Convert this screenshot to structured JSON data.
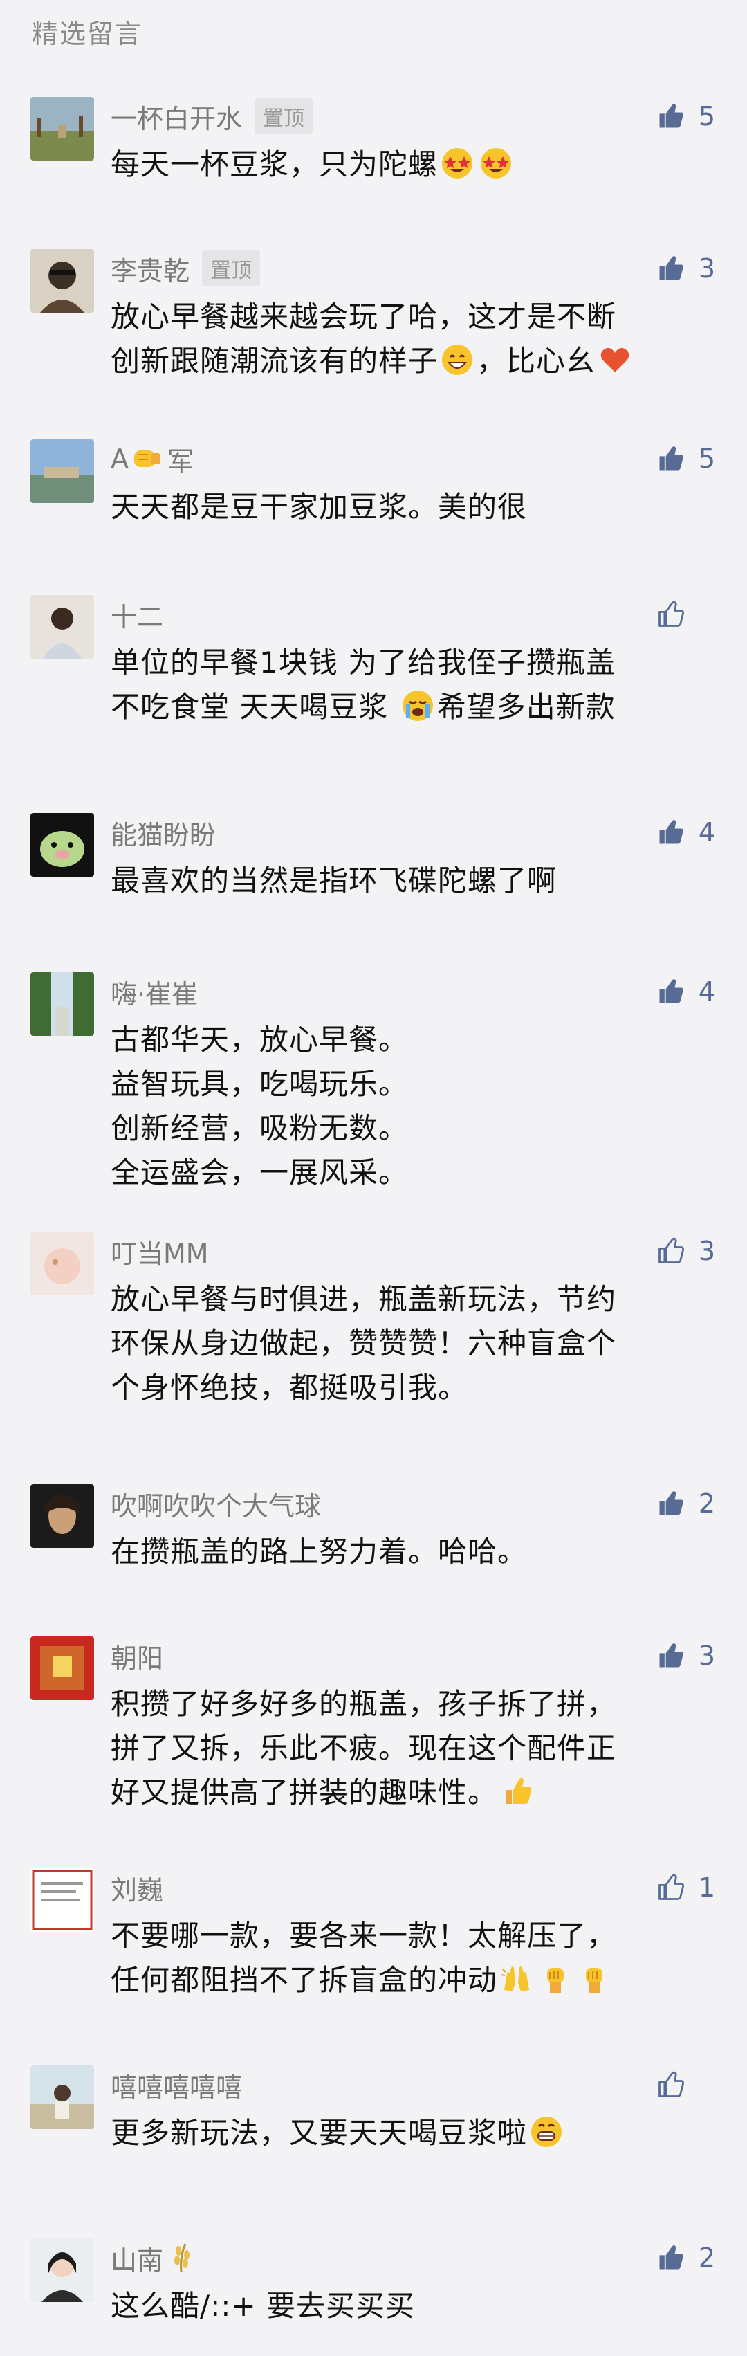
{
  "section_title": "精选留言",
  "pin_label": "置顶",
  "comments": [
    {
      "name": "一杯白开水",
      "pinned": true,
      "likes": "5",
      "liked": true,
      "lines": [
        [
          "每天一杯豆浆，只为陀螺",
          "star-eyes-emoji",
          "star-eyes-emoji"
        ]
      ]
    },
    {
      "name": "李贵乾",
      "pinned": true,
      "likes": "3",
      "liked": true,
      "lines": [
        [
          "放心早餐越来越会玩了哈，这才是不断"
        ],
        [
          "创新跟随潮流该有的样子",
          "grin-emoji",
          "，比心幺",
          "heart-emoji"
        ]
      ]
    },
    {
      "name": "A",
      "name_icon": "fist-emoji",
      "name_after": "军",
      "pinned": false,
      "likes": "5",
      "liked": true,
      "lines": [
        [
          "天天都是豆干家加豆浆。美的很"
        ]
      ]
    },
    {
      "name": "十二",
      "pinned": false,
      "likes": "",
      "liked": false,
      "lines": [
        [
          "单位的早餐1块钱 为了给我侄子攒瓶盖"
        ],
        [
          "不吃食堂 天天喝豆浆 ",
          "crying-emoji",
          "希望多出新款"
        ]
      ]
    },
    {
      "name": "能猫盼盼",
      "pinned": false,
      "likes": "4",
      "liked": true,
      "lines": [
        [
          "最喜欢的当然是指环飞碟陀螺了啊"
        ]
      ]
    },
    {
      "name": "嗨·崔崔",
      "pinned": false,
      "likes": "4",
      "liked": true,
      "lines": [
        [
          "古都华天，放心早餐。"
        ],
        [
          "益智玩具，吃喝玩乐。"
        ],
        [
          "创新经营，吸粉无数。"
        ],
        [
          "全运盛会，一展风采。"
        ]
      ]
    },
    {
      "name": "叮当MM",
      "pinned": false,
      "likes": "3",
      "liked": false,
      "lines": [
        [
          "放心早餐与时俱进，瓶盖新玩法，节约"
        ],
        [
          "环保从身边做起，赞赞赞！六种盲盒个"
        ],
        [
          "个身怀绝技，都挺吸引我。"
        ]
      ]
    },
    {
      "name": "吹啊吹吹个大气球",
      "pinned": false,
      "likes": "2",
      "liked": true,
      "lines": [
        [
          "在攒瓶盖的路上努力着。哈哈。"
        ]
      ]
    },
    {
      "name": "朝阳",
      "pinned": false,
      "likes": "3",
      "liked": true,
      "lines": [
        [
          "积攒了好多好多的瓶盖，孩子拆了拼，"
        ],
        [
          "拼了又拆，乐此不疲。现在这个配件正"
        ],
        [
          "好又提供高了拼装的趣味性。",
          "thumbs-emoji"
        ]
      ]
    },
    {
      "name": "刘巍",
      "pinned": false,
      "likes": "1",
      "liked": false,
      "lines": [
        [
          "不要哪一款，要各来一款！太解压了，"
        ],
        [
          "任何都阻挡不了拆盲盒的冲动",
          "raised-hands-emoji",
          "fist-raised-emoji",
          "fist-raised-emoji"
        ]
      ]
    },
    {
      "name": "嘻嘻嘻嘻嘻",
      "pinned": false,
      "likes": "",
      "liked": false,
      "lines": [
        [
          "更多新玩法，又要天天喝豆浆啦",
          "big-grin-emoji"
        ]
      ]
    },
    {
      "name": "山南",
      "name_icon": "rice-emoji",
      "name_after": "",
      "pinned": false,
      "likes": "2",
      "liked": true,
      "lines": [
        [
          "这么酷/::+ 要去买买买"
        ]
      ]
    }
  ],
  "colors": {
    "like_blue": "#576b95",
    "name_gray": "#7a7a7a",
    "background": "#f3f3f5"
  }
}
